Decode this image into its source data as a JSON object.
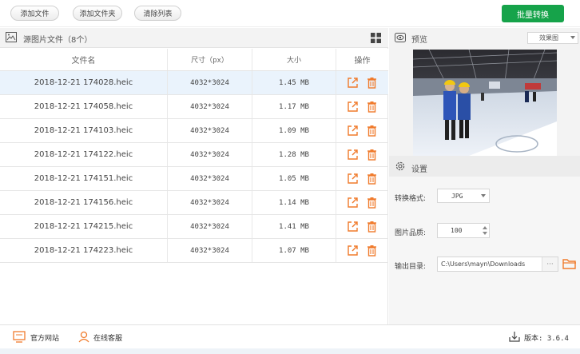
{
  "toolbar": {
    "add_file": "添加文件",
    "add_folder": "添加文件夹",
    "clear_list": "清除列表",
    "batch_convert": "批量转换"
  },
  "file_panel": {
    "title": "源图片文件（8个）",
    "columns": [
      "文件名",
      "尺寸（px）",
      "大小",
      "操作"
    ],
    "rows": [
      {
        "name": "2018-12-21 174028.heic",
        "dimensions": "4032*3024",
        "size": "1.45 MB"
      },
      {
        "name": "2018-12-21 174058.heic",
        "dimensions": "4032*3024",
        "size": "1.17 MB"
      },
      {
        "name": "2018-12-21 174103.heic",
        "dimensions": "4032*3024",
        "size": "1.09 MB"
      },
      {
        "name": "2018-12-21 174122.heic",
        "dimensions": "4032*3024",
        "size": "1.28 MB"
      },
      {
        "name": "2018-12-21 174151.heic",
        "dimensions": "4032*3024",
        "size": "1.05 MB"
      },
      {
        "name": "2018-12-21 174156.heic",
        "dimensions": "4032*3024",
        "size": "1.14 MB"
      },
      {
        "name": "2018-12-21 174215.heic",
        "dimensions": "4032*3024",
        "size": "1.41 MB"
      },
      {
        "name": "2018-12-21 174223.heic",
        "dimensions": "4032*3024",
        "size": "1.07 MB"
      }
    ],
    "selected_row": 0
  },
  "preview": {
    "title": "预览",
    "mode": "效果图"
  },
  "settings": {
    "title": "设置",
    "format_label": "转换格式:",
    "format_value": "JPG",
    "quality_label": "图片品质:",
    "quality_value": "100",
    "output_label": "输出目录:",
    "output_path": "C:\\Users\\mayn\\Downloads",
    "browse": "···"
  },
  "footer": {
    "website": "官方网站",
    "support": "在线客服",
    "version": "版本: 3.6.4"
  },
  "colors": {
    "accent_green": "#16a34a",
    "action_orange": "#f07b2c",
    "selected_row": "#eaf3fc"
  },
  "icons": [
    "image-icon",
    "grid-view-icon",
    "eye-icon",
    "gear-icon",
    "open-external-icon",
    "trash-icon",
    "folder-icon",
    "monitor-icon",
    "support-agent-icon",
    "download-icon"
  ]
}
